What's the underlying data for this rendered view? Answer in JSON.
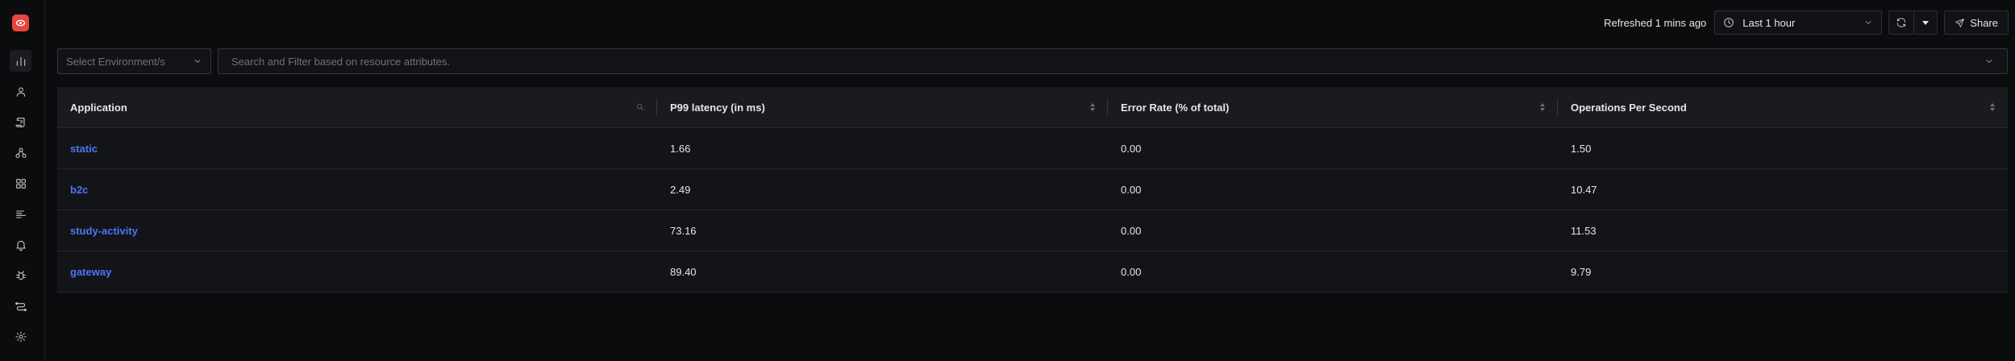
{
  "topbar": {
    "refreshed_text": "Refreshed 1 mins ago",
    "time_range": "Last 1 hour",
    "share_label": "Share"
  },
  "filters": {
    "environment_placeholder": "Select Environment/s",
    "search_placeholder": "Search and Filter based on resource attributes."
  },
  "sidebar": {
    "items": [
      {
        "icon": "bar-chart-icon",
        "active": true
      },
      {
        "icon": "user-icon"
      },
      {
        "icon": "scroll-icon"
      },
      {
        "icon": "service-map-icon"
      },
      {
        "icon": "dashboard-grid-icon"
      },
      {
        "icon": "logs-lines-icon"
      },
      {
        "icon": "alert-bell-icon"
      },
      {
        "icon": "bug-icon"
      },
      {
        "icon": "pipelines-icon"
      },
      {
        "icon": "gear-icon"
      }
    ]
  },
  "table": {
    "columns": [
      "Application",
      "P99 latency (in ms)",
      "Error Rate (% of total)",
      "Operations Per Second"
    ],
    "rows": [
      {
        "application": "static",
        "p99": "1.66",
        "error_rate": "0.00",
        "ops": "1.50"
      },
      {
        "application": "b2c",
        "p99": "2.49",
        "error_rate": "0.00",
        "ops": "10.47"
      },
      {
        "application": "study-activity",
        "p99": "73.16",
        "error_rate": "0.00",
        "ops": "11.53"
      },
      {
        "application": "gateway",
        "p99": "89.40",
        "error_rate": "0.00",
        "ops": "9.79"
      }
    ]
  },
  "colors": {
    "link": "#4e74f8",
    "brand": "#e8453c",
    "background": "#0b0c0e"
  }
}
